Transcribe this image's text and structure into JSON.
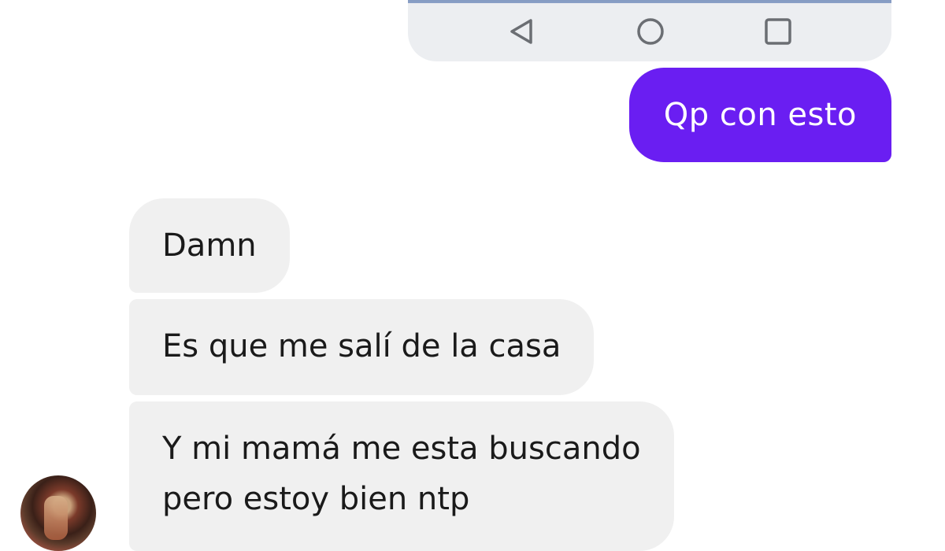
{
  "shared_screenshot": {
    "nav_buttons": [
      {
        "icon": "back-triangle-icon"
      },
      {
        "icon": "home-circle-icon"
      },
      {
        "icon": "recents-square-icon"
      }
    ]
  },
  "messages": [
    {
      "direction": "outgoing",
      "text": "Qp con esto",
      "color": "#6a1ef2"
    },
    {
      "direction": "incoming",
      "text": "Damn"
    },
    {
      "direction": "incoming",
      "text": "Es que me salí de la casa"
    },
    {
      "direction": "incoming",
      "lines": [
        "Y mi mamá me esta buscando",
        "pero estoy bien ntp"
      ]
    }
  ],
  "colors": {
    "outgoing_bubble": "#6a1ef2",
    "incoming_bubble": "#f0f0f0",
    "background": "#ffffff"
  },
  "contact": {
    "avatar_icon": "contact-avatar"
  }
}
